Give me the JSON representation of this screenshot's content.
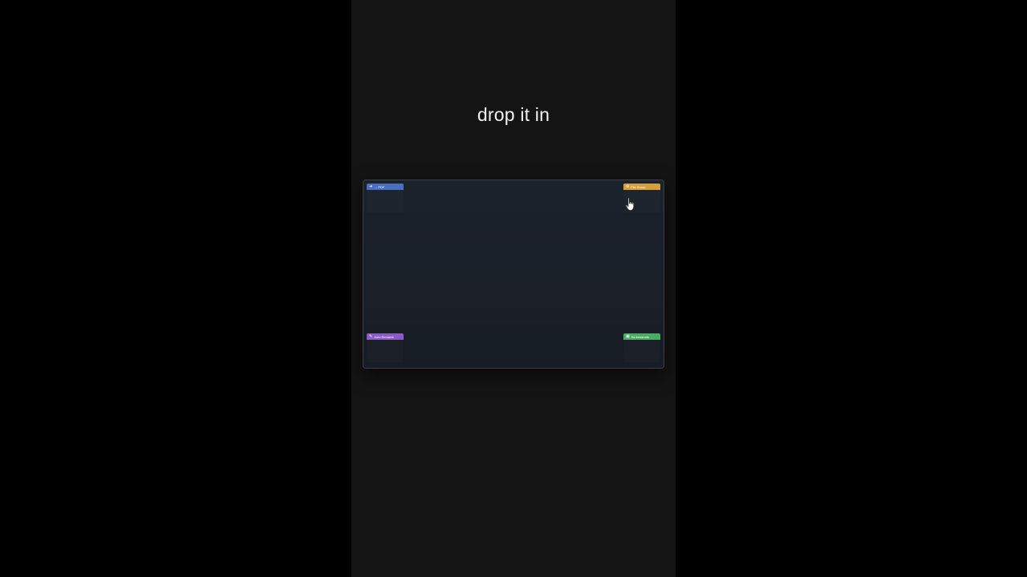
{
  "caption": "drop it in",
  "zones": {
    "top_left": {
      "label": "→ PDF",
      "color": "#4a6fc0",
      "icon": "arrow-icon"
    },
    "top_right": {
      "label": "File Share",
      "color": "#d4a03a",
      "icon": "share-icon"
    },
    "bottom_left": {
      "label": "Auto Rename",
      "color": "#8a5cc4",
      "icon": "pencil-icon"
    },
    "bottom_right": {
      "label": "Screenshots",
      "color": "#4caa64",
      "icon": "folder-icon"
    }
  }
}
